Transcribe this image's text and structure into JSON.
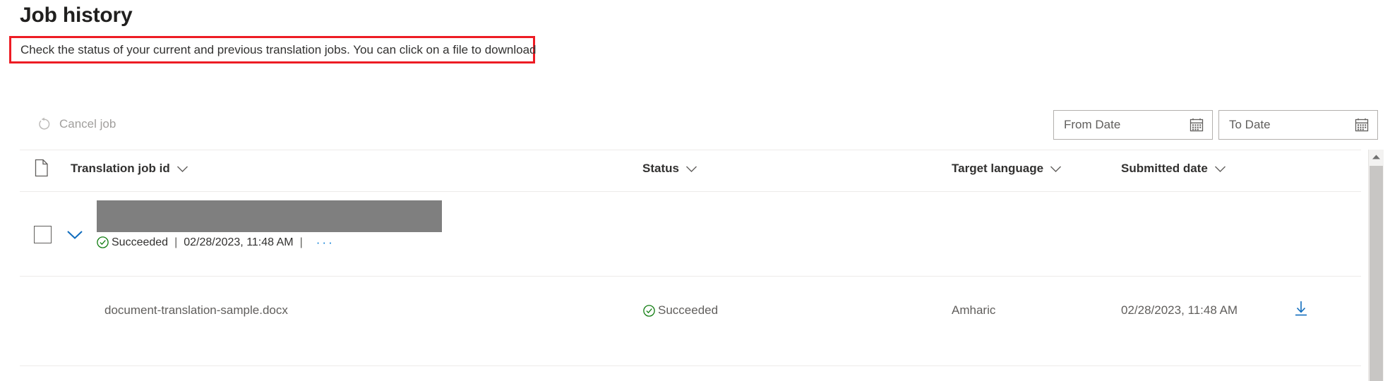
{
  "header": {
    "title": "Job history",
    "description": "Check the status of your current and previous translation jobs. You can click on a file to download",
    "highlight_color": "#ed1c24"
  },
  "command_bar": {
    "cancel_job": {
      "label": "Cancel job",
      "icon": "cancel-job-icon",
      "disabled": true
    },
    "from_date": {
      "placeholder": "From Date",
      "value": "",
      "icon": "calendar-icon"
    },
    "to_date": {
      "placeholder": "To Date",
      "value": "",
      "icon": "calendar-icon"
    }
  },
  "table": {
    "columns": [
      {
        "key": "jobid",
        "label": "Translation job id",
        "sortable": true
      },
      {
        "key": "status",
        "label": "Status",
        "sortable": true
      },
      {
        "key": "target",
        "label": "Target language",
        "sortable": true
      },
      {
        "key": "submitted",
        "label": "Submitted date",
        "sortable": true
      }
    ],
    "group_row": {
      "job_id_redacted": "",
      "expanded": true,
      "checked": false,
      "status": "Succeeded",
      "separator": "|",
      "submitted": "02/28/2023, 11:48 AM",
      "more_actions": "···",
      "status_color": "#107c10"
    },
    "rows": [
      {
        "filename": "document-translation-sample.docx",
        "status": "Succeeded",
        "target_language": "Amharic",
        "submitted_date": "02/28/2023, 11:48 AM",
        "download_label": "Download",
        "status_color": "#107c10",
        "download_color": "#0078d4"
      }
    ]
  },
  "scrollbar": {
    "up_arrow": "scroll-up-arrow",
    "orientation": "vertical"
  }
}
